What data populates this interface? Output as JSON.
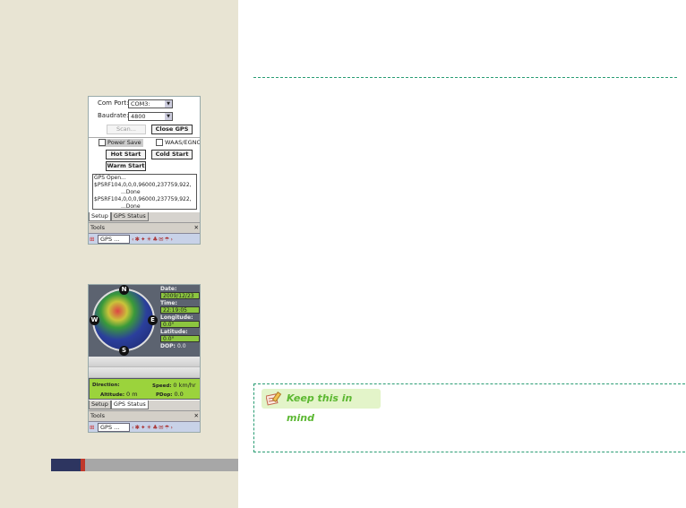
{
  "setup_screen": {
    "com_port_label": "Com Port:",
    "com_port_value": "COM3:",
    "baudrate_label": "Baudrate:",
    "baudrate_value": "4800",
    "scan_label": "Scan...",
    "close_gps_label": "Close GPS",
    "power_save_label": "Power Save",
    "waas_label": "WAAS/EGNOS",
    "hot_start_label": "Hot Start",
    "cold_start_label": "Cold Start",
    "warm_start_label": "Warm Start",
    "log": [
      "GPS Open...",
      "$PSRF104,0,0,0,96000,237759,922,",
      "...Done",
      "$PSRF104,0,0,0,96000,237759,922,",
      "...Done"
    ],
    "tabs": [
      "Setup",
      "GPS Status"
    ],
    "menu_label": "Tools",
    "close_label": "✕",
    "task_label": "GPS ..."
  },
  "status_screen": {
    "date_label": "Date:",
    "date_value": "2009/12/23",
    "time_label": "Time:",
    "time_value": "22:19:05",
    "longitude_label": "Longitude:",
    "longitude_value": "0.0°",
    "latitude_label": "Latitude:",
    "latitude_value": "0.0°",
    "dop_label": "DOP:",
    "dop_value": "0.0",
    "compass": [
      "N",
      "E",
      "S",
      "W"
    ],
    "direction_label": "Direction:",
    "speed_label": "Speed:",
    "speed_value": "0 km/hr",
    "altitude_label": "Altitude:",
    "altitude_value": "0 m",
    "pdop_label": "PDop:",
    "pdop_value": "0.0",
    "tabs": [
      "Setup",
      "GPS Status"
    ],
    "menu_label": "Tools",
    "close_label": "✕",
    "task_label": "GPS ..."
  },
  "note": {
    "title": "Keep this in mind"
  },
  "colors": {
    "sidebar": "#e8e4d3",
    "accent_green": "#2a9d74",
    "note_green": "#5cb832"
  }
}
